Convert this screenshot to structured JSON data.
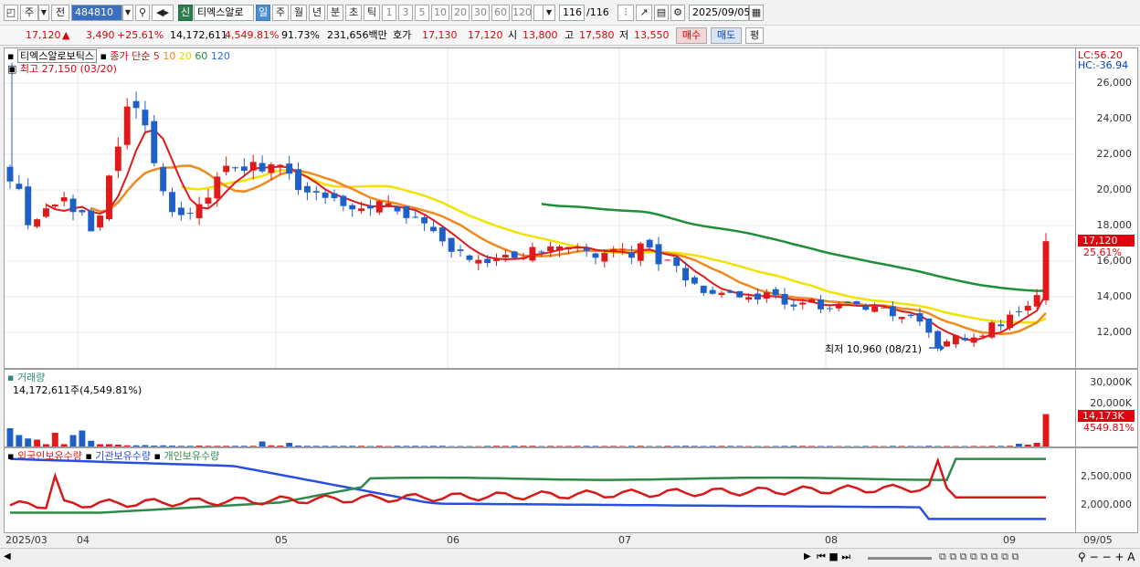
{
  "toolbar": {
    "market_label": "주",
    "period_label": "전",
    "code": "484810",
    "new_badge": "신",
    "stock_name": "티엑스알로",
    "tf_day": "일",
    "tf_week": "주",
    "tf_month": "월",
    "tf_year": "년",
    "tf_min": "분",
    "tf_sec": "초",
    "tf_tick": "틱",
    "intervals": [
      "1",
      "3",
      "5",
      "10",
      "20",
      "30",
      "60",
      "120"
    ],
    "count": "116",
    "count_total": "/116",
    "date": "2025/09/05"
  },
  "quote": {
    "price": "17,120",
    "change": "3,490",
    "change_pct": "+25.61%",
    "volume": "14,172,611",
    "volume_pct": "4,549.81%",
    "turnover_pct": "91.73%",
    "amount": "231,656백만",
    "ask_label": "호가",
    "ask": "17,130",
    "bid": "17,120",
    "open_label": "시",
    "open": "13,800",
    "high_label": "고",
    "high": "17,580",
    "low_label": "저",
    "low": "13,550",
    "buy_btn": "매수",
    "sell_btn": "매도",
    "eval_btn": "평"
  },
  "price_pane": {
    "legend_name": "티엑스알로보틱스",
    "legend_ma": "종가 단순",
    "ma_periods": [
      "5",
      "10",
      "20",
      "60",
      "120"
    ],
    "max_label": "최고 27,150 (03/20)",
    "min_label": "최저 10,960 (08/21)",
    "lc_label": "LC:56.20",
    "hc_label": "HC:-36.94",
    "last_price": "17,120",
    "last_pct": "25.61%",
    "yticks": [
      "26,000",
      "24,000",
      "22,000",
      "20,000",
      "18,000",
      "16,000",
      "14,000",
      "12,000"
    ]
  },
  "volume_pane": {
    "title": "거래량",
    "value_label": "14,172,611주(4,549.81%)",
    "yticks": [
      "30,000K",
      "20,000K",
      "10,000K"
    ],
    "last_value": "14,173K",
    "last_pct": "4549.81%"
  },
  "holdings_pane": {
    "legend_foreign": "외국인보유수량",
    "legend_inst": "기관보유수량",
    "legend_indiv": "개인보유수량",
    "yticks": [
      "2,500,000",
      "2,000,000"
    ]
  },
  "xaxis": {
    "labels": [
      "2025/03",
      "04",
      "05",
      "06",
      "07",
      "08",
      "09",
      "09/05"
    ]
  },
  "colors": {
    "up": "#e01a1a",
    "down": "#1e5fc8",
    "ma5": "#e01a1a",
    "ma10": "#f08a1c",
    "ma20": "#f2e200",
    "ma60": "#1f8f3a",
    "ma120": "#2a6ee8",
    "foreign": "#d81818",
    "inst": "#2a4ee0",
    "indiv": "#2e8a4a"
  },
  "chart_data": {
    "type": "candlestick",
    "price_range": [
      10500,
      27500
    ],
    "candles_sample": [
      {
        "date": "03/20",
        "high": 27150
      },
      {
        "date": "08/21",
        "low": 10960
      },
      {
        "date": "09/05",
        "open": 13800,
        "high": 17580,
        "low": 13550,
        "close": 17120
      }
    ],
    "volume_last": 14172611
  }
}
